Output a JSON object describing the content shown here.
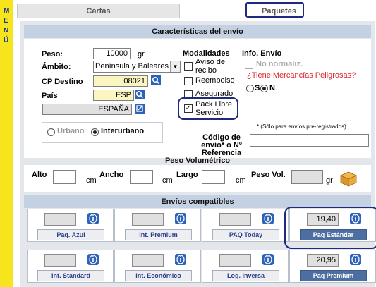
{
  "menu": {
    "letters": [
      "M",
      "E",
      "N",
      "Ú"
    ]
  },
  "tabs": [
    {
      "label": "Cartas"
    },
    {
      "label": "Paquetes"
    }
  ],
  "sections": {
    "characteristics": "Características del envío",
    "volumetric": "Peso Volumétrico",
    "compatible": "Envíos compatibles"
  },
  "form": {
    "peso_label": "Peso:",
    "peso_value": "10000",
    "peso_unit": "gr",
    "ambito_label": "Ámbito:",
    "ambito_value": "Península y Baleares",
    "cp_label": "CP Destino",
    "cp_value": "08021",
    "pais_label": "País",
    "pais_value": "ESP",
    "city_value": "ESPAÑA",
    "urbano_label": "Urbano",
    "interurbano_label": "Interurbano",
    "codigo_label": "Código de envío* o Nº Referencia",
    "codigo_note": "* (Sólo para envíos pre-registrados)",
    "codigo_value": ""
  },
  "modalidades": {
    "title": "Modalidades",
    "items": [
      {
        "label": "Aviso de recibo",
        "checked": false
      },
      {
        "label": "Reembolso",
        "checked": false
      },
      {
        "label": "Asegurado",
        "checked": false
      },
      {
        "label": "Pack Libre Servicio",
        "checked": true
      }
    ]
  },
  "info_envio": {
    "title": "Info. Envío",
    "no_normaliz": "No normaliz.",
    "dangerous": "¿Tiene Mercancías Peligrosas?",
    "si": "S",
    "no": "N"
  },
  "volumetric": {
    "alto": "Alto",
    "ancho": "Ancho",
    "largo": "Largo",
    "unit_cm": "cm",
    "peso_vol": "Peso Vol.",
    "unit_gr": "gr"
  },
  "envios": [
    {
      "name": "Paq. Azul",
      "price": "",
      "active": false
    },
    {
      "name": "Int. Premium",
      "price": "",
      "active": false
    },
    {
      "name": "PAQ Today",
      "price": "",
      "active": false
    },
    {
      "name": "Paq Estándar",
      "price": "19,40",
      "active": true
    },
    {
      "name": "Int. Standard",
      "price": "",
      "active": false
    },
    {
      "name": "Int. Económico",
      "price": "",
      "active": false
    },
    {
      "name": "Log. Inversa",
      "price": "",
      "active": false
    },
    {
      "name": "Paq Premium",
      "price": "20,95",
      "active": true
    }
  ],
  "colors": {
    "accent": "#1d2a80",
    "menu": "#f6e51c",
    "section": "#c4d1e3",
    "panel": "#e3e6ea"
  }
}
